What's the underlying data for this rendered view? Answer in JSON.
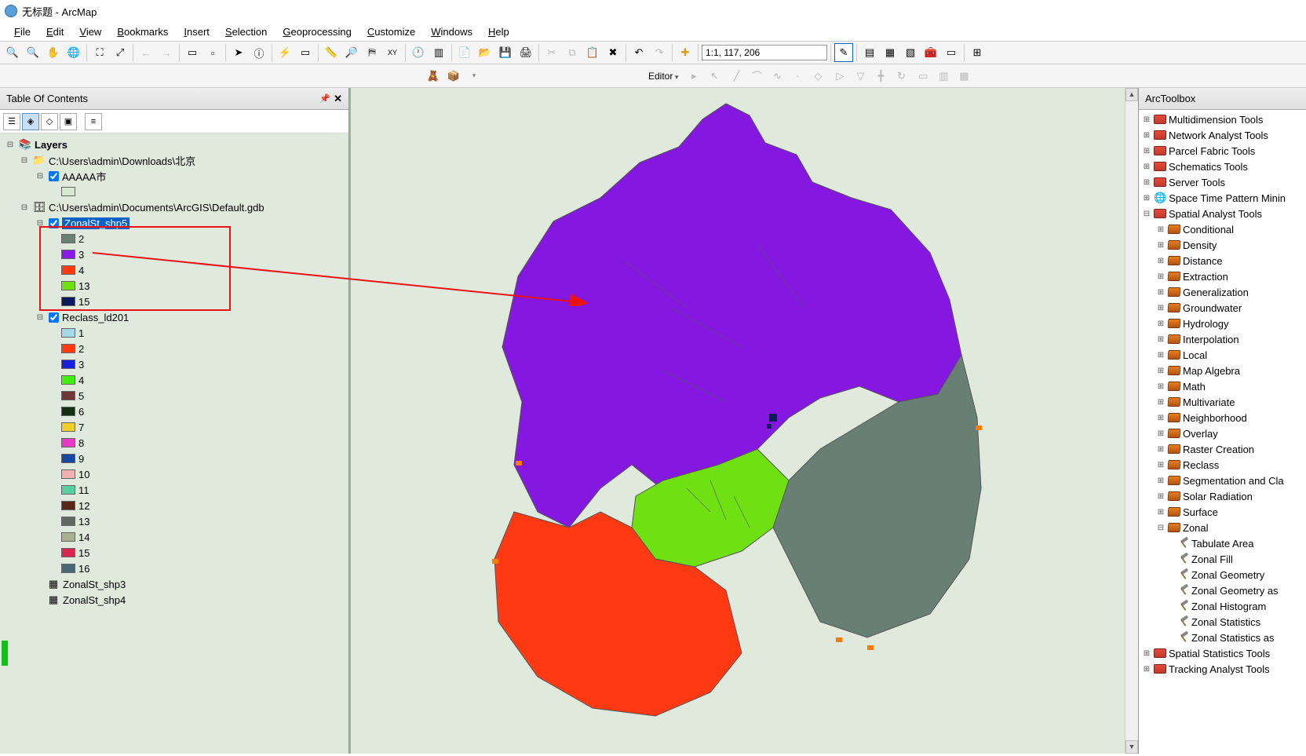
{
  "titlebar": {
    "text": "无标题 - ArcMap"
  },
  "menu": [
    "File",
    "Edit",
    "View",
    "Bookmarks",
    "Insert",
    "Selection",
    "Geoprocessing",
    "Customize",
    "Windows",
    "Help"
  ],
  "scale": "1:1, 117, 206",
  "editor_label": "Editor",
  "toc": {
    "title": "Table Of Contents",
    "layers_label": "Layers",
    "path1": "C:\\Users\\admin\\Downloads\\北京",
    "lyr1": "AAAAA市",
    "path2": "C:\\Users\\admin\\Documents\\ArcGIS\\Default.gdb",
    "zonal": "ZonalSt_shp5",
    "zonal_vals": [
      {
        "v": "2",
        "c": "#6a8070"
      },
      {
        "v": "3",
        "c": "#8a18e6"
      },
      {
        "v": "4",
        "c": "#ff3a12"
      },
      {
        "v": "13",
        "c": "#6fe012"
      },
      {
        "v": "15",
        "c": "#0a1a5a"
      }
    ],
    "reclass": "Reclass_ld201",
    "reclass_vals": [
      {
        "v": "1",
        "c": "#a5d8e8"
      },
      {
        "v": "2",
        "c": "#ff3a12"
      },
      {
        "v": "3",
        "c": "#1820d8"
      },
      {
        "v": "4",
        "c": "#42f010"
      },
      {
        "v": "5",
        "c": "#703838"
      },
      {
        "v": "6",
        "c": "#143014"
      },
      {
        "v": "7",
        "c": "#f0d028"
      },
      {
        "v": "8",
        "c": "#e838c8"
      },
      {
        "v": "9",
        "c": "#1848a0"
      },
      {
        "v": "10",
        "c": "#f0b0b0"
      },
      {
        "v": "11",
        "c": "#58d0a0"
      },
      {
        "v": "12",
        "c": "#582818"
      },
      {
        "v": "13",
        "c": "#606860"
      },
      {
        "v": "14",
        "c": "#a8b090"
      },
      {
        "v": "15",
        "c": "#d82850"
      },
      {
        "v": "16",
        "c": "#486878"
      }
    ],
    "tbl1": "ZonalSt_shp3",
    "tbl2": "ZonalSt_shp4"
  },
  "arctoolbox": {
    "title": "ArcToolbox",
    "top": [
      "Multidimension Tools",
      "Network Analyst Tools",
      "Parcel Fabric Tools",
      "Schematics Tools",
      "Server Tools"
    ],
    "stpm": "Space Time Pattern Minin",
    "sat": "Spatial Analyst Tools",
    "sat_sub": [
      "Conditional",
      "Density",
      "Distance",
      "Extraction",
      "Generalization",
      "Groundwater",
      "Hydrology",
      "Interpolation",
      "Local",
      "Map Algebra",
      "Math",
      "Multivariate",
      "Neighborhood",
      "Overlay",
      "Raster Creation",
      "Reclass",
      "Segmentation and Cla",
      "Solar Radiation",
      "Surface"
    ],
    "zonal": "Zonal",
    "zonal_tools": [
      "Tabulate Area",
      "Zonal Fill",
      "Zonal Geometry",
      "Zonal Geometry as",
      "Zonal Histogram",
      "Zonal Statistics",
      "Zonal Statistics as"
    ],
    "bottom": [
      "Spatial Statistics Tools",
      "Tracking Analyst Tools"
    ]
  }
}
